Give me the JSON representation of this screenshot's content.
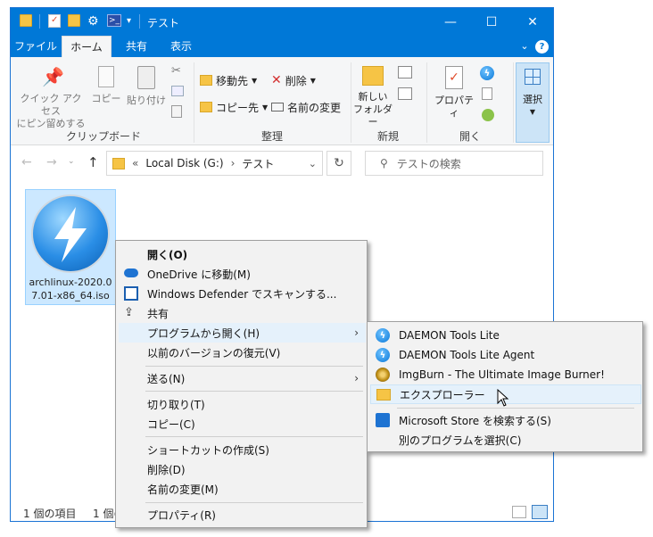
{
  "window": {
    "title": "テスト",
    "controls": {
      "minimize": "—",
      "maximize": "☐",
      "close": "✕"
    }
  },
  "tabs": [
    {
      "label": "ファイル"
    },
    {
      "label": "ホーム"
    },
    {
      "label": "共有"
    },
    {
      "label": "表示"
    }
  ],
  "ribbon": {
    "clipboard": {
      "pin_label": "クイック アクセス\nにピン留めする",
      "copy_label": "コピー",
      "paste_label": "貼り付け",
      "group_label": "クリップボード"
    },
    "organize": {
      "move_to": "移動先",
      "copy_to": "コピー先",
      "delete": "削除",
      "rename": "名前の変更",
      "group_label": "整理"
    },
    "new": {
      "new_folder": "新しい\nフォルダー",
      "group_label": "新規"
    },
    "open": {
      "properties": "プロパティ",
      "group_label": "開く"
    },
    "select": {
      "select_label": "選択"
    }
  },
  "nav": {
    "breadcrumb_prefix": "«",
    "drive": "Local Disk (G:)",
    "folder": "テスト",
    "search_placeholder": "テストの検索"
  },
  "file": {
    "name": "archlinux-2020.07.01-x86_64.iso"
  },
  "status": {
    "items_count": "1 個の項目",
    "selected": "1 個の"
  },
  "context_menu": {
    "items": [
      {
        "label": "開く(O)"
      },
      {
        "label": "OneDrive に移動(M)"
      },
      {
        "label": "Windows Defender でスキャンする..."
      },
      {
        "label": "共有"
      },
      {
        "label": "プログラムから開く(H)"
      },
      {
        "label": "以前のバージョンの復元(V)"
      },
      {
        "label": "送る(N)"
      },
      {
        "label": "切り取り(T)"
      },
      {
        "label": "コピー(C)"
      },
      {
        "label": "ショートカットの作成(S)"
      },
      {
        "label": "削除(D)"
      },
      {
        "label": "名前の変更(M)"
      },
      {
        "label": "プロパティ(R)"
      }
    ]
  },
  "submenu": {
    "items": [
      {
        "label": "DAEMON Tools Lite"
      },
      {
        "label": "DAEMON Tools Lite Agent"
      },
      {
        "label": "ImgBurn - The Ultimate Image Burner!"
      },
      {
        "label": "エクスプローラー"
      },
      {
        "label": "Microsoft Store を検索する(S)"
      },
      {
        "label": "別のプログラムを選択(C)"
      }
    ]
  }
}
